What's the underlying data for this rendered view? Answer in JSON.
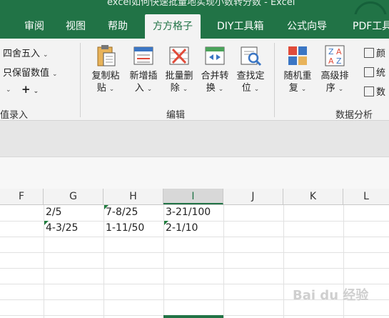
{
  "window": {
    "title": "excel如何快速批量地实现小数转分数 - Excel"
  },
  "tabs": [
    {
      "label": "审阅",
      "active": false
    },
    {
      "label": "视图",
      "active": false
    },
    {
      "label": "帮助",
      "active": false
    },
    {
      "label": "方方格子",
      "active": true
    },
    {
      "label": "DIY工具箱",
      "active": false
    },
    {
      "label": "公式向导",
      "active": false
    },
    {
      "label": "PDF工具",
      "active": false
    }
  ],
  "ribbon": {
    "left": {
      "round_label": "四舍五入",
      "keep_values_label": "只保留数值",
      "plus_symbol": "+",
      "group_label": "值录入"
    },
    "edit": {
      "buttons": [
        {
          "line1": "复制粘",
          "line2": "贴",
          "icon": "clipboard-icon"
        },
        {
          "line1": "新增插",
          "line2": "入",
          "icon": "insert-icon"
        },
        {
          "line1": "批量删",
          "line2": "除",
          "icon": "delete-icon"
        },
        {
          "line1": "合并转",
          "line2": "换",
          "icon": "merge-convert-icon"
        },
        {
          "line1": "查找定",
          "line2": "位",
          "icon": "find-locate-icon"
        }
      ],
      "group_label": "编辑"
    },
    "analysis": {
      "buttons": [
        {
          "line1": "随机重",
          "line2": "复",
          "icon": "random-repeat-icon"
        },
        {
          "line1": "高级排",
          "line2": "序",
          "icon": "sort-az-icon"
        }
      ],
      "small_buttons": [
        {
          "label": "颜",
          "icon": "color-icon"
        },
        {
          "label": "统",
          "icon": "stats-icon"
        },
        {
          "label": "数",
          "icon": "data-icon"
        }
      ],
      "group_label": "数据分析"
    }
  },
  "sheet": {
    "columns": [
      "F",
      "G",
      "H",
      "I",
      "J",
      "K",
      "L"
    ],
    "selected_column": "I",
    "rows": [
      [
        "",
        "2/5",
        "7-8/25",
        "3-21/100",
        "",
        "",
        ""
      ],
      [
        "",
        "4-3/25",
        "1-11/50",
        "2-1/10",
        "",
        "",
        ""
      ]
    ]
  },
  "watermark": {
    "text": "Bai du 经验"
  },
  "colors": {
    "accent": "#217346",
    "ribbon_bg": "#f3f3f3",
    "error_triangle": "#1e7b3c"
  }
}
